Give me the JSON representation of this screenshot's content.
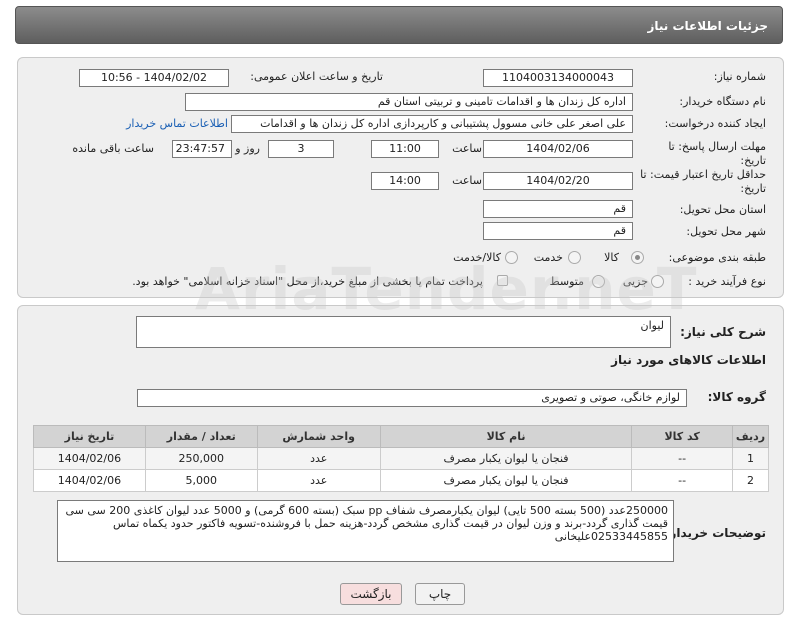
{
  "header": {
    "title": "جزئیات اطلاعات نیاز"
  },
  "form": {
    "need_number_label": "شماره نیاز:",
    "need_number": "1104003134000043",
    "announce_label": "تاریخ و ساعت اعلان عمومی:",
    "announce_value": "1404/02/02 - 10:56",
    "buyer_label": "نام دستگاه خریدار:",
    "buyer_value": "اداره کل زندان ها و اقدامات تامینی و تربیتی استان قم",
    "creator_label": "ایجاد کننده درخواست:",
    "creator_value": "علی اصغر علی خانی مسوول پشتیبانی و کارپردازی اداره کل زندان ها و اقدامات",
    "buyer_contact_link": "اطلاعات تماس خریدار",
    "deadline_label": "مهلت ارسال پاسخ: تا تاریخ:",
    "deadline_date": "1404/02/06",
    "time_label": "ساعت",
    "deadline_time": "11:00",
    "days_value": "3",
    "days_and_label": "روز و",
    "remaining_time": "23:47:57",
    "remaining_label": "ساعت باقی مانده",
    "validity_label": "حداقل تاریخ اعتبار قیمت: تا تاریخ:",
    "validity_date": "1404/02/20",
    "validity_time": "14:00",
    "province_label": "استان محل تحویل:",
    "province_value": "قم",
    "city_label": "شهر محل تحویل:",
    "city_value": "قم",
    "category_label": "طبقه بندی موضوعی:",
    "category_options": [
      "کالا",
      "خدمت",
      "کالا/خدمت"
    ],
    "category_selected": "کالا",
    "process_label": "نوع فرآیند خرید :",
    "process_options": [
      "جزیی",
      "متوسط"
    ],
    "payment_note": "پرداخت تمام یا بخشی از مبلغ خرید،از محل \"اسناد خزانه اسلامی\" خواهد بود."
  },
  "watermark": "AriaTender.neT",
  "details": {
    "summary_label": "شرح کلی نیاز:",
    "summary_value": "لیوان",
    "goods_info_title": "اطلاعات کالاهای مورد نیاز",
    "goods_group_label": "گروه کالا:",
    "goods_group_value": "لوازم خانگی، صوتی و تصویری",
    "table": {
      "headers": [
        "ردیف",
        "کد کالا",
        "نام کالا",
        "واحد شمارش",
        "تعداد / مقدار",
        "تاریخ نیاز"
      ],
      "rows": [
        [
          "1",
          "--",
          "فنجان یا لیوان یکبار مصرف",
          "عدد",
          "250,000",
          "1404/02/06"
        ],
        [
          "2",
          "--",
          "فنجان یا لیوان یکبار مصرف",
          "عدد",
          "5,000",
          "1404/02/06"
        ]
      ]
    },
    "buyer_notes_label": "توضیحات خریدار:",
    "buyer_notes": "250000عدد (500 بسته 500 تایی) لیوان یکبارمصرف شفاف  pp سبک (بسته 600 گرمی) و 5000 عدد لیوان کاغذی 200 سی سی قیمت گذاری گردد-برند و وزن لیوان در قیمت گذاری مشخص گردد-هزینه حمل با فروشنده-تسویه فاکتور حدود یکماه تماس 02533445855علیخانی"
  },
  "buttons": {
    "print": "چاپ",
    "back": "بازگشت"
  }
}
